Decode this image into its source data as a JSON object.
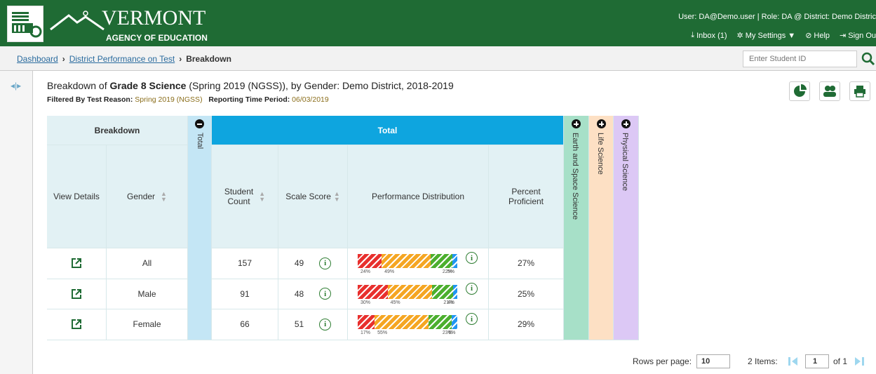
{
  "header": {
    "logo_main": "VERMONT",
    "logo_sub": "AGENCY OF EDUCATION",
    "user_info": "User: DA@Demo.user  |  Role: DA @ District: Demo Distric",
    "inbox": "Inbox (1)",
    "settings": "My Settings ▼",
    "help": "Help",
    "signout": "Sign Ou"
  },
  "breadcrumb": {
    "dashboard": "Dashboard",
    "district_perf": "District Performance on Test",
    "current": "Breakdown",
    "search_placeholder": "Enter Student ID"
  },
  "report": {
    "title_pre": "Breakdown of ",
    "title_bold": "Grade 8 Science",
    "title_post": " (Spring 2019 (NGSS)), by Gender: Demo District, 2018-2019",
    "filter_label1": "Filtered By Test Reason:",
    "filter_value1": "Spring 2019 (NGSS)",
    "filter_label2": "Reporting Time Period:",
    "filter_value2": "06/03/2019"
  },
  "table": {
    "group_breakdown": "Breakdown",
    "group_total_collapsed": "Total",
    "group_total": "Total",
    "col_view": "View Details",
    "col_gender": "Gender",
    "col_count": "Student\nCount",
    "col_scale": "Scale Score",
    "col_perf": "Performance Distribution",
    "col_pct": "Percent\nProficient",
    "side_earth": "Earth and Space Science",
    "side_life": "Life Science",
    "side_phys": "Physical Science",
    "rows": [
      {
        "gender": "All",
        "count": "157",
        "scale": "49",
        "dist": [
          24,
          49,
          22,
          5
        ],
        "dist_labels": [
          "24%",
          "49%",
          "22%",
          "5%"
        ],
        "pct": "27%"
      },
      {
        "gender": "Male",
        "count": "91",
        "scale": "48",
        "dist": [
          30,
          45,
          21,
          4
        ],
        "dist_labels": [
          "30%",
          "45%",
          "21%",
          "4%"
        ],
        "pct": "25%"
      },
      {
        "gender": "Female",
        "count": "66",
        "scale": "51",
        "dist": [
          17,
          55,
          23,
          6
        ],
        "dist_labels": [
          "17%",
          "55%",
          "23%",
          "6%"
        ],
        "pct": "29%"
      }
    ],
    "dist_colors": [
      "#e8302e",
      "#f5a623",
      "#4caf2e",
      "#2196f3"
    ]
  },
  "footer": {
    "rows_per_page_label": "Rows per page:",
    "rows_per_page": "10",
    "items": "2 Items:",
    "page": "1",
    "of": "of 1"
  }
}
